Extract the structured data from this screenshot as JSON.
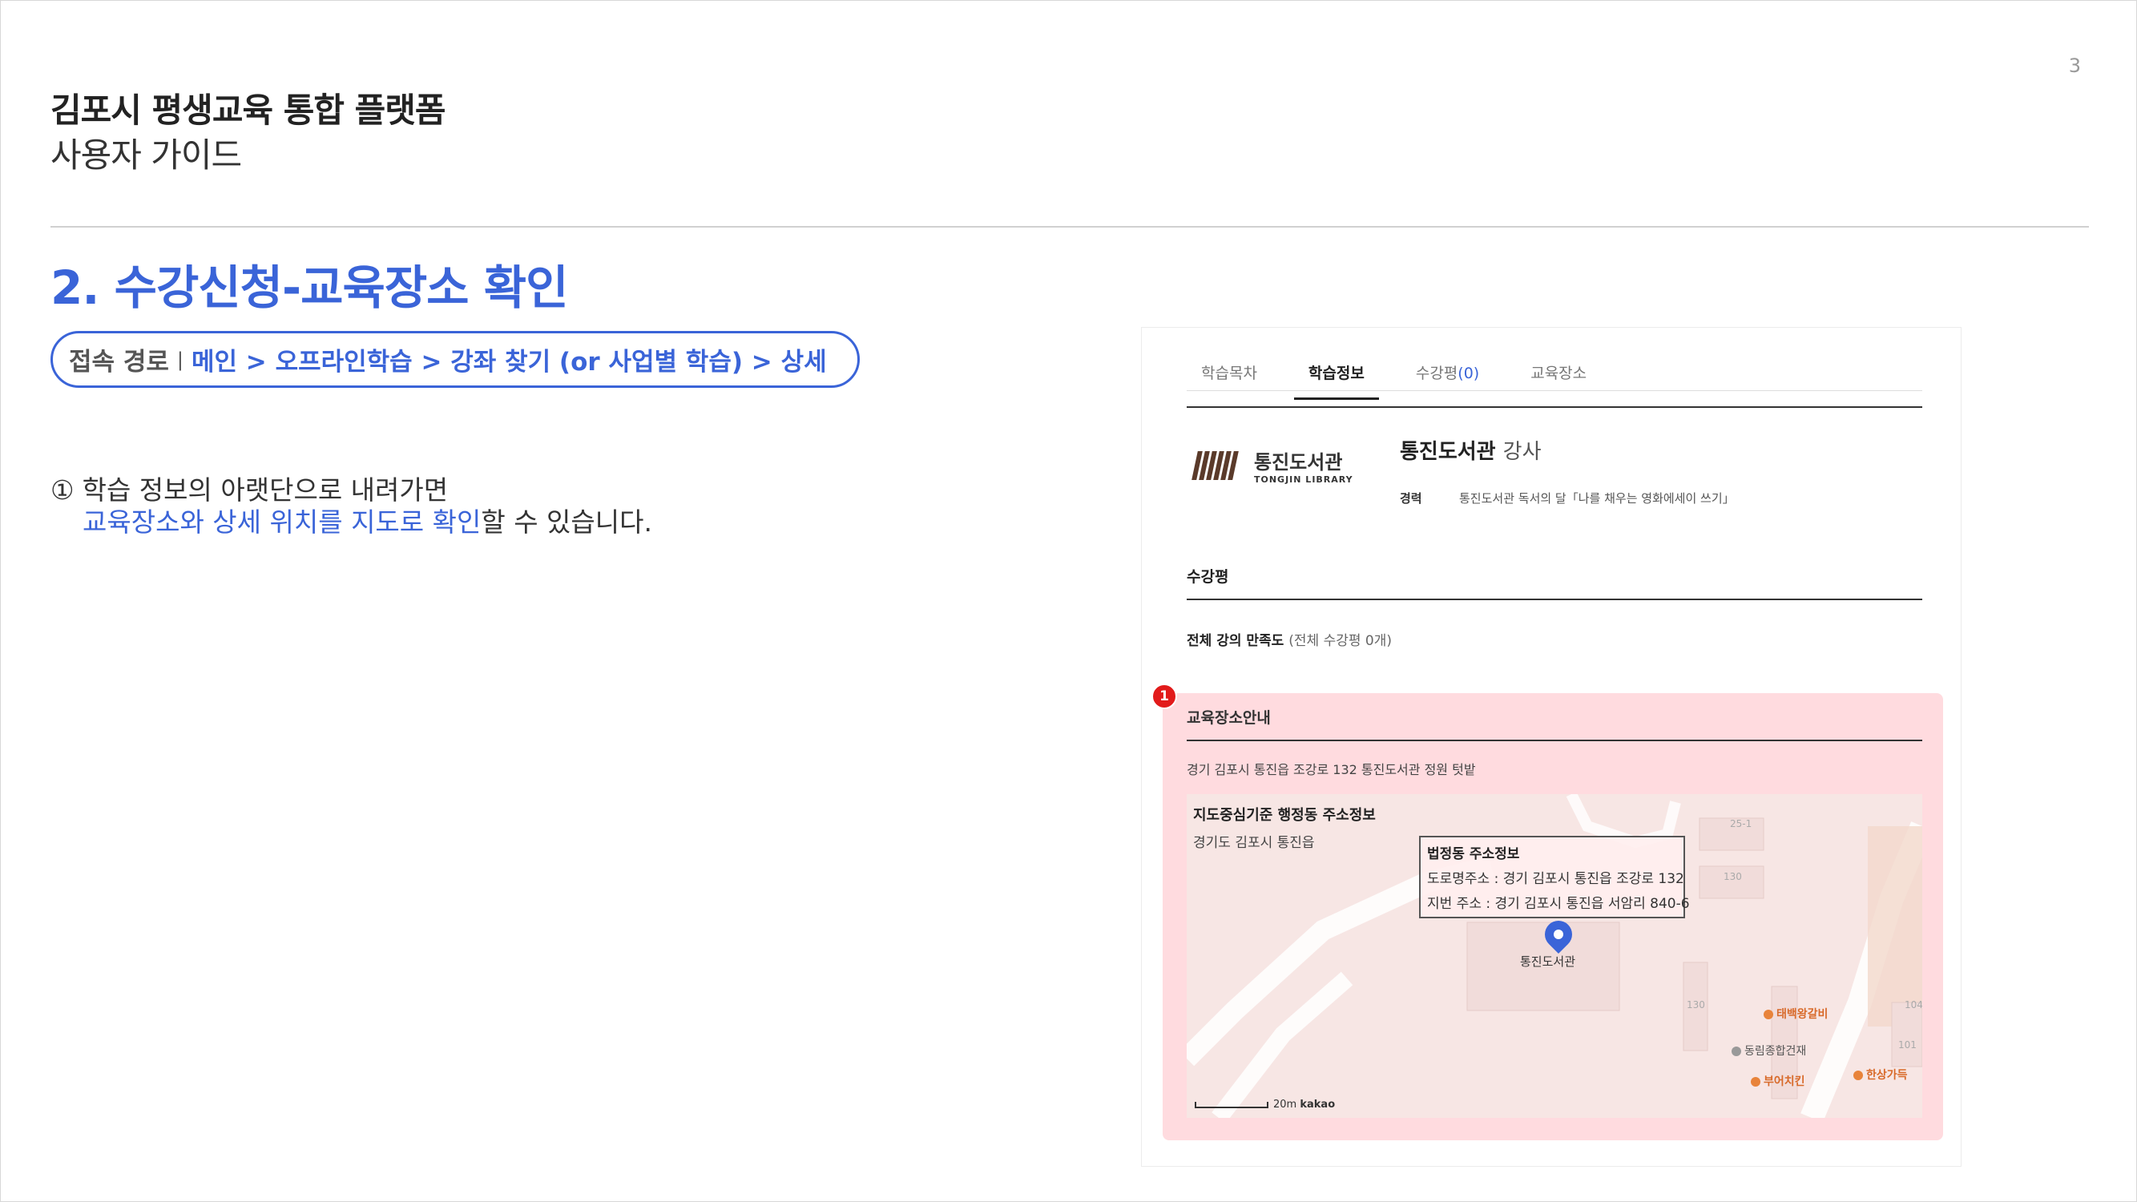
{
  "page": {
    "number": "3",
    "title": "김포시 평생교육 통합 플랫폼",
    "subtitle": "사용자 가이드",
    "section_title": "2. 수강신청-교육장소 확인"
  },
  "access_path": {
    "label": "접속 경로",
    "separator": "|",
    "value": "메인 > 오프라인학습 > 강좌 찾기 (or 사업별 학습) > 상세"
  },
  "description": {
    "marker": "①",
    "line1": "학습 정보의 아랫단으로 내려가면",
    "line2_highlight": "교육장소와 상세 위치를 지도로 확인",
    "line2_rest": "할 수 있습니다."
  },
  "screenshot": {
    "tabs": [
      {
        "label": "학습목차",
        "count": "",
        "active": false
      },
      {
        "label": "학습정보",
        "count": "",
        "active": true
      },
      {
        "label": "수강평",
        "count": "(0)",
        "active": false
      },
      {
        "label": "교육장소",
        "count": "",
        "active": false
      }
    ],
    "logo": {
      "kr": "통진도서관",
      "en": "TONGJIN LIBRARY"
    },
    "instructor": {
      "name": "통진도서관",
      "role": "강사"
    },
    "career": {
      "label": "경력",
      "text": "통진도서관 독서의 달「나를 채우는 영화에세이 쓰기」"
    },
    "review": {
      "heading": "수강평",
      "satisfaction_label": "전체 강의 만족도",
      "satisfaction_detail": "(전체 수강평 0개)"
    },
    "badge": "1",
    "location": {
      "heading": "교육장소안내",
      "address": "경기 김포시 통진읍 조강로 132 통진도서관 정원 텃밭"
    },
    "map": {
      "admin_info_title": "지도중심기준 행정동 주소정보",
      "admin_info_address": "경기도 김포시 통진읍",
      "popup_title": "법정동 주소정보",
      "popup_road": "도로명주소 : 경기 김포시 통진읍 조강로 132",
      "popup_lot": "지번 주소 : 경기 김포시 통진읍 서암리 840-6",
      "pin_label": "통진도서관",
      "pois": [
        "태백왕갈비",
        "동림종합건재",
        "부어치킨",
        "한상가득"
      ],
      "building_numbers": [
        "25-1",
        "130",
        "130",
        "104",
        "101"
      ],
      "scale_text": "20m",
      "provider": "kakao"
    }
  }
}
